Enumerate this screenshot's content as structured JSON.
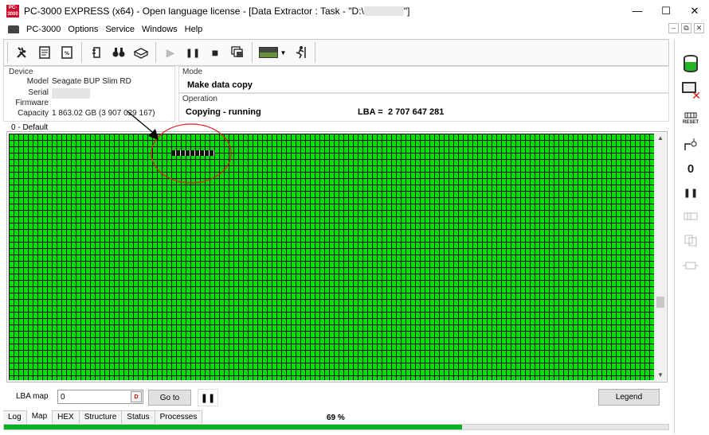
{
  "window": {
    "title_prefix": "PC-3000 EXPRESS (x64) - Open language license - [Data Extractor : Task - \"D:\\",
    "title_suffix": "\"]",
    "app_icon_text": "PC-3000",
    "minimize": "—",
    "maximize": "☐",
    "close": "✕"
  },
  "menu": {
    "items": [
      "PC-3000",
      "Options",
      "Service",
      "Windows",
      "Help"
    ],
    "mdi": [
      "–",
      "⧉",
      "✕"
    ]
  },
  "toolbar": {
    "icons": [
      "tools-icon",
      "sector-editor-icon",
      "test-percent-icon",
      "config-icon",
      "binoculars-icon",
      "disk-icon",
      "play-icon",
      "pause-icon",
      "stop-icon",
      "copy-windows-icon",
      "screen-thumb-icon",
      "runner-icon"
    ],
    "pause_glyph": "❚❚",
    "stop_glyph": "■",
    "play_glyph": "▶"
  },
  "device": {
    "group_label": "Device",
    "model_label": "Model",
    "model_value": "Seagate BUP Slim RD",
    "serial_label": "Serial",
    "firmware_label": "Firmware",
    "capacity_label": "Capacity",
    "capacity_value": "1 863.02 GB (3 907 029 167)"
  },
  "mode": {
    "group_label": "Mode",
    "value": "Make data copy"
  },
  "operation": {
    "group_label": "Operation",
    "status": "Copying - running",
    "lba_label": "LBA =",
    "lba_value": "2 707 647 281"
  },
  "map": {
    "title": "0 - Default",
    "ok_color": "#00e000",
    "bad_color": "#111111",
    "annotation_color": "#e02020"
  },
  "sidebar": {
    "reset_label": "RESET",
    "zero_label": "0",
    "pause_glyph": "❚❚"
  },
  "controls": {
    "lba_map_label": "LBA map",
    "lba_map_value": "0",
    "dec_badge": "D",
    "goto_label": "Go to",
    "pause_glyph": "❚❚",
    "legend_label": "Legend"
  },
  "tabs": [
    "Log",
    "Map",
    "HEX",
    "Structure",
    "Status",
    "Processes"
  ],
  "active_tab": "Map",
  "progress": {
    "percent_text": "69 %",
    "value": 0.69,
    "color": "#06b025"
  }
}
